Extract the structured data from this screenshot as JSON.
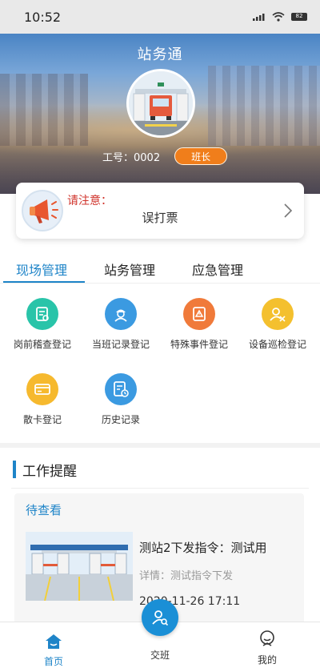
{
  "status_bar": {
    "time": "10:52",
    "battery": "82"
  },
  "header": {
    "title": "站务通",
    "employee_id": "工号：0002",
    "role": "班长"
  },
  "notice": {
    "label": "请注意：",
    "text": "误打票"
  },
  "tabs": [
    {
      "label": "现场管理",
      "active": true
    },
    {
      "label": "站务管理",
      "active": false
    },
    {
      "label": "应急管理",
      "active": false
    }
  ],
  "grid": [
    {
      "label": "岗前稽查登记",
      "icon": "clipboard-search-icon",
      "color": "#29c4a9"
    },
    {
      "label": "当班记录登记",
      "icon": "worker-icon",
      "color": "#3b9ae1"
    },
    {
      "label": "特殊事件登记",
      "icon": "warning-doc-icon",
      "color": "#f07a3a"
    },
    {
      "label": "设备巡检登记",
      "icon": "user-inspect-icon",
      "color": "#f4c02e"
    },
    {
      "label": "散卡登记",
      "icon": "card-icon",
      "color": "#f6b92e"
    },
    {
      "label": "历史记录",
      "icon": "history-doc-icon",
      "color": "#3b9ae1"
    }
  ],
  "reminders": {
    "section_title": "工作提醒",
    "pending_label": "待查看",
    "item": {
      "title": "测站2下发指令：测试用",
      "detail": "详情：测试指令下发",
      "time": "2020-11-26 17:11"
    }
  },
  "bottom_nav": {
    "home": "首页",
    "handover": "交班",
    "mine": "我的"
  },
  "colors": {
    "primary": "#1e84c8",
    "accent_orange": "#f07e1b",
    "notice_red": "#d0342c"
  }
}
